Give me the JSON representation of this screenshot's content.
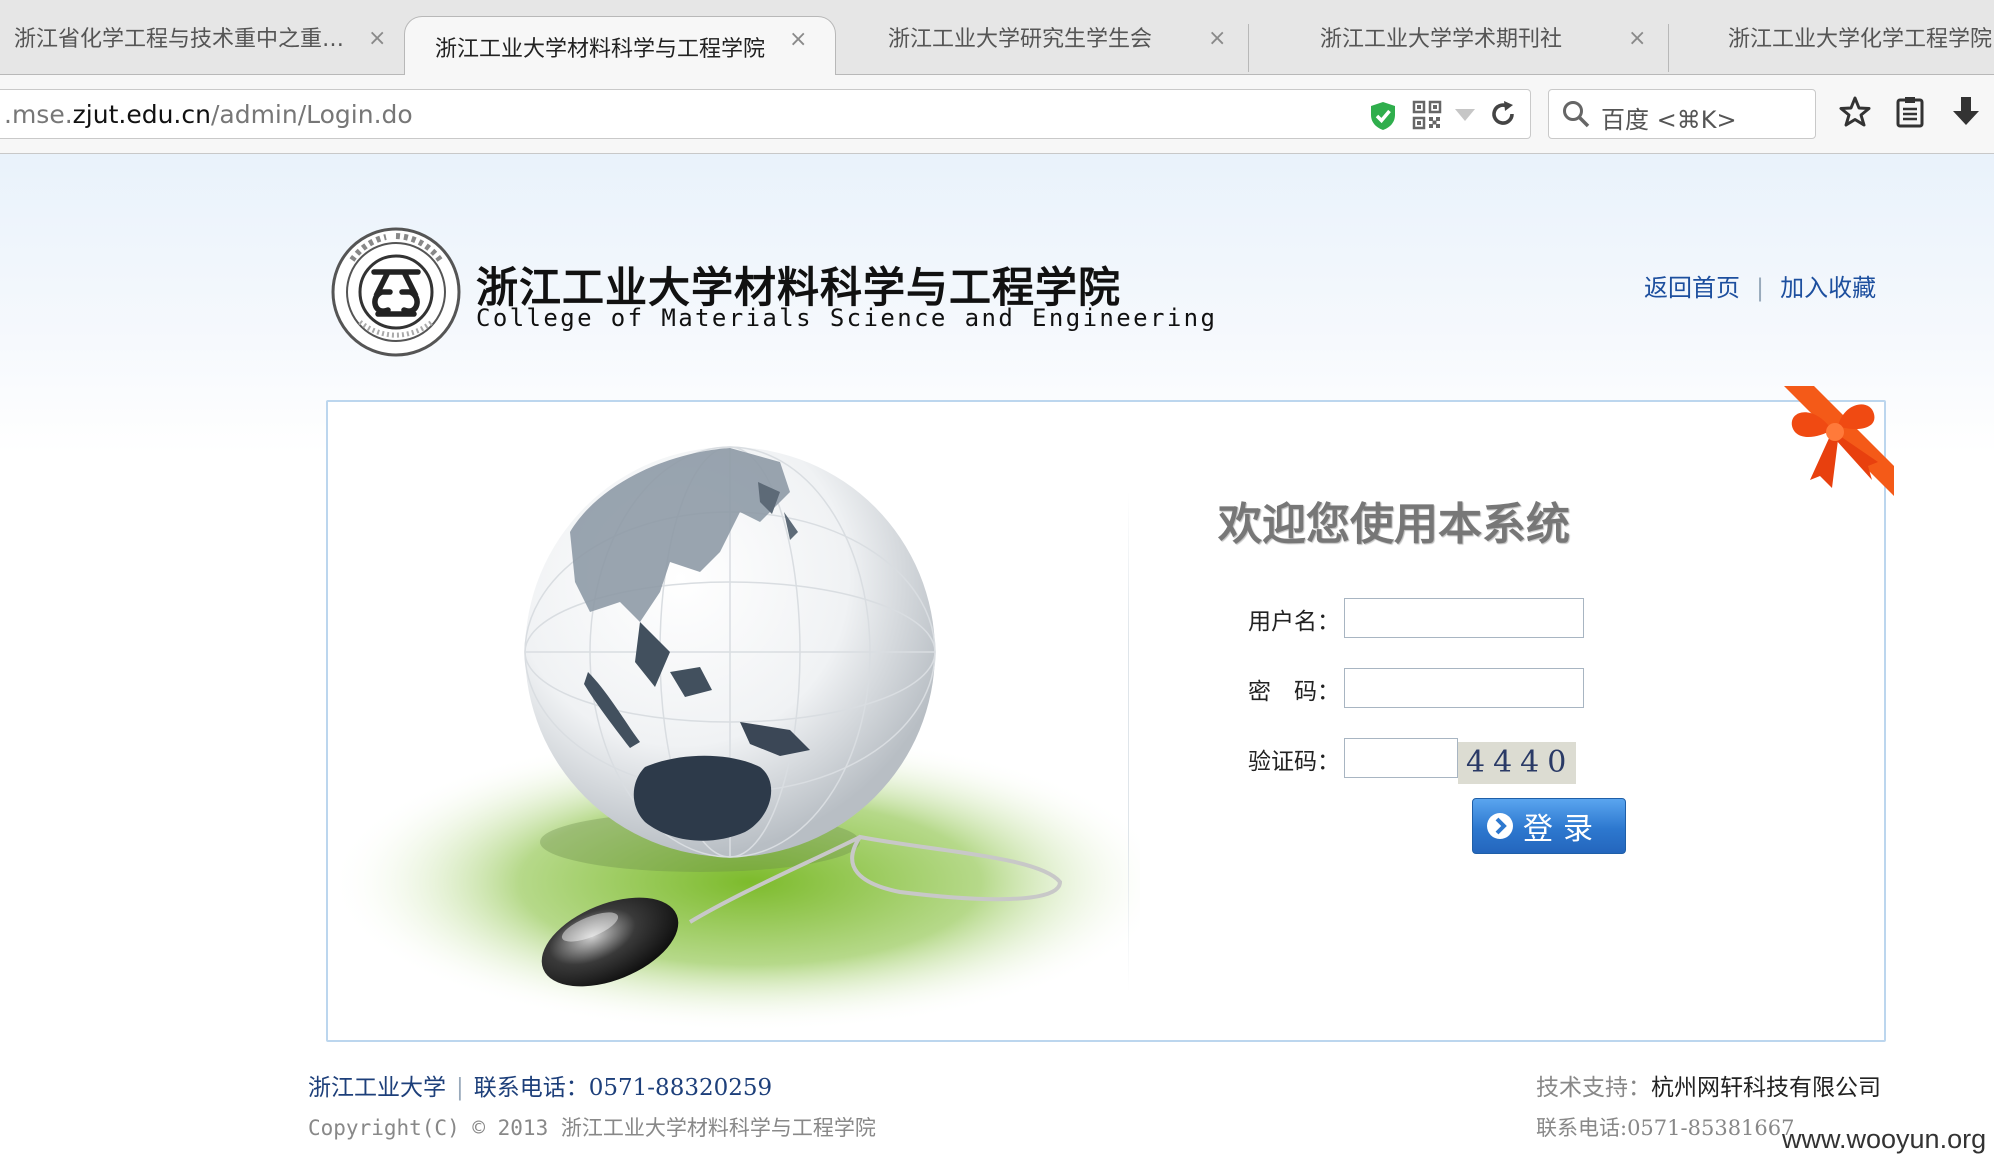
{
  "browser": {
    "tabs": [
      {
        "label": "浙江省化学工程与技术重中之重…",
        "active": false
      },
      {
        "label": "浙江工业大学材料科学与工程学院",
        "active": true
      },
      {
        "label": "浙江工业大学研究生学生会",
        "active": false
      },
      {
        "label": "浙江工业大学学术期刊社",
        "active": false
      },
      {
        "label": "浙江工业大学化学工程学院",
        "active": false
      }
    ],
    "tab_close": "×",
    "url_prefix": ".mse.",
    "url_host": "zjut.edu.cn",
    "url_path": "/admin/Login.do",
    "search_placeholder": "百度 <⌘K>"
  },
  "header": {
    "title_cn": "浙江工业大学材料科学与工程学院",
    "title_en": "College of Materials Science and Engineering",
    "link_home": "返回首页",
    "link_sep": "|",
    "link_favorite": "加入收藏"
  },
  "login": {
    "welcome": "欢迎您使用本系统",
    "username_label": "用户名：",
    "username_value": "",
    "password_label": "密　码：",
    "password_value": "",
    "captcha_label": "验证码：",
    "captcha_value": "",
    "captcha_code": "4440",
    "submit_label": "登录"
  },
  "footer": {
    "school": "浙江工业大学",
    "sep": "|",
    "phone": "联系电话：0571-88320259",
    "copyright": "Copyright(C) © 2013 浙江工业大学材料科学与工程学院",
    "support_label": "技术支持：",
    "support_company": "杭州网轩科技有限公司",
    "support_phone": "联系电话:0571-85381667"
  },
  "watermark": "www.wooyun.org",
  "colors": {
    "link_blue": "#1d4f9e",
    "button_blue": "#2d78cf",
    "card_border": "#bcd6ee",
    "ribbon_orange": "#f04a12"
  }
}
